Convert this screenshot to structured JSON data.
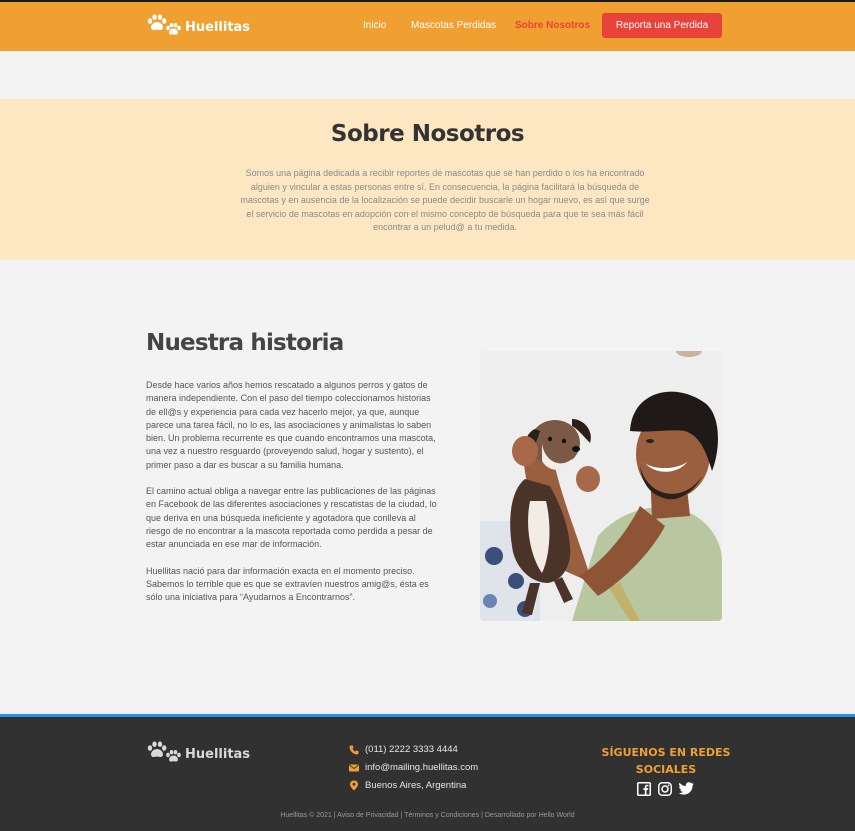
{
  "brand": {
    "name": "Huellitas"
  },
  "nav": {
    "items": [
      {
        "label": "Inicio"
      },
      {
        "label": "Mascotas Perdidas"
      },
      {
        "label": "Sobre Nosotros"
      }
    ],
    "report_label": "Reporta una Perdida"
  },
  "about": {
    "title": "Sobre Nosotros",
    "text": "Somos una página dedicada a recibir reportes de mascotas que se han perdido o los ha encontrado alguien y vincular a estas personas entre sí. En consecuencia, la página facilitará la búsqueda de mascotas y en ausencia de la localización se puede decidir buscarle un hogar nuevo, es así que surge el servicio de mascotas en adopción con el mismo concepto de búsqueda para que te sea más fácil encontrar a un pelud@ a tu medida."
  },
  "history": {
    "title": "Nuestra historia",
    "paragraphs": [
      "Desde hace varios años hemos rescatado a algunos perros y gatos de manera independiente. Con el paso del tiempo coleccionamos historias de ell@s y experiencia para cada vez hacerlo mejor, ya que, aunque parece una tarea fácil, no lo es, las asociaciones y animalistas lo saben bien. Un problema recurrente es que cuando encontramos una mascota, una vez a nuestro resguardo (proveyendo salud, hogar y sustento), el primer paso a dar es buscar a su familia humana.",
      "El camino actual obliga a navegar entre las publicaciones de las páginas en Facebook de las diferentes asociaciones y rescatistas de la ciudad, lo que deriva en una búsqueda ineficiente y agotadora que conlleva al riesgo de no encontrar a la mascota reportada como perdida a pesar de estar anunciada en ese mar de información.",
      "Huellitas nació para dar información exacta en el momento preciso. Sabemos lo terrible que es que se extravíen nuestros amig@s, ésta es sólo una iniciativa para “Ayudarnos a Encontrarnos”."
    ]
  },
  "footer": {
    "phone": "(011) 2222 3333 4444",
    "email": "info@mailing.huellitas.com",
    "location": "Buenos Aires, Argentina",
    "social_title": "SÍGUENOS EN REDES SOCIALES",
    "copyright": "Huellitas © 2021 | Aviso de Privacidad | Términos y Condiciones | Desarrollado por Hello World"
  },
  "colors": {
    "primary": "#f0a030",
    "accent": "#e8433a",
    "hero_bg": "#fde7c3",
    "footer_bg": "#313131",
    "footer_border": "#2a8fe6"
  },
  "icons": {
    "logo": "paw-icon",
    "phone": "phone-icon",
    "email": "mail-icon",
    "location": "pin-icon",
    "social": [
      "facebook-icon",
      "instagram-icon",
      "twitter-icon"
    ]
  }
}
